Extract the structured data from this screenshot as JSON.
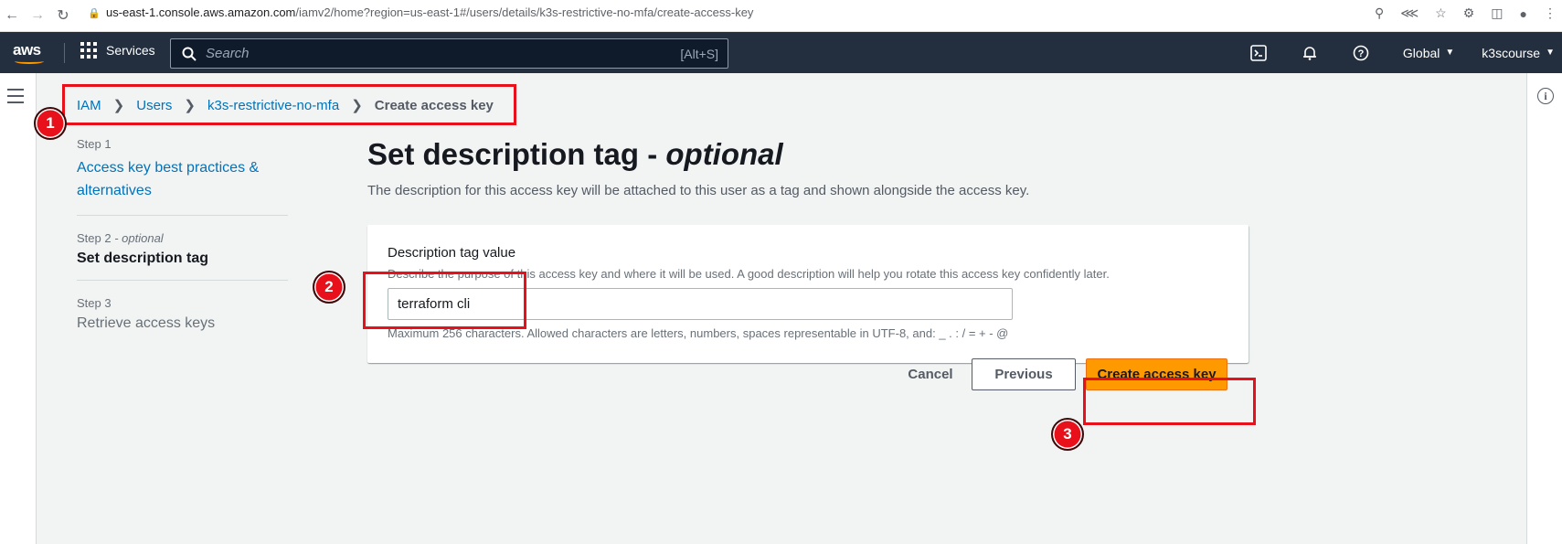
{
  "browser": {
    "url_host": "us-east-1.console.aws.amazon.com",
    "url_path": "/iamv2/home?region=us-east-1#/users/details/k3s-restrictive-no-mfa/create-access-key"
  },
  "topnav": {
    "brand": "aws",
    "services_label": "Services",
    "search_placeholder": "Search",
    "search_shortcut": "[Alt+S]",
    "region_label": "Global",
    "user_label": "k3scourse"
  },
  "breadcrumb": {
    "items": [
      "IAM",
      "Users",
      "k3s-restrictive-no-mfa"
    ],
    "current": "Create access key"
  },
  "steps": [
    {
      "label": "Step 1",
      "title": "Access key best practices & alternatives"
    },
    {
      "label": "Step 2",
      "label_suffix": " - optional",
      "title": "Set description tag"
    },
    {
      "label": "Step 3",
      "title": "Retrieve access keys"
    }
  ],
  "content": {
    "title": "Set description tag - ",
    "title_italic": "optional",
    "description": "The description for this access key will be attached to this user as a tag and shown alongside the access key.",
    "field_label": "Description tag value",
    "field_description": "Describe the purpose of this access key and where it will be used. A good description will help you rotate this access key confidently later.",
    "field_value": "terraform cli",
    "field_hint": "Maximum 256 characters. Allowed characters are letters, numbers, spaces representable in UTF-8, and: _ . : / = + - @"
  },
  "actions": {
    "cancel": "Cancel",
    "previous": "Previous",
    "create": "Create access key"
  },
  "annotations": [
    "1",
    "2",
    "3"
  ],
  "colors": {
    "nav_bg": "#232f3e",
    "accent_orange": "#ff9900",
    "link_blue": "#0073bb",
    "annotation_red": "#e8101a"
  }
}
